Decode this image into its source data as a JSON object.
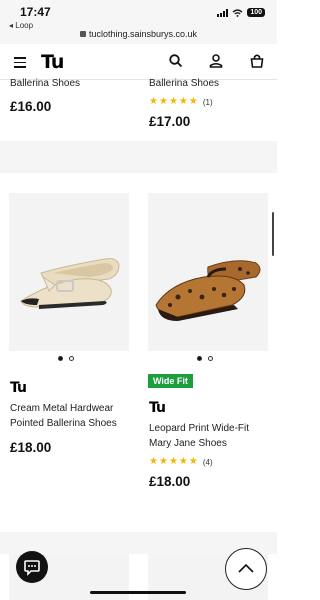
{
  "status_bar": {
    "time": "17:47",
    "back_label": "◂ Loop",
    "url": "tuclothing.sainsburys.co.uk",
    "battery": "100"
  },
  "header": {
    "logo": "Tu"
  },
  "top_row": {
    "left": {
      "title": "Ballerina Shoes",
      "price": "£16.00"
    },
    "right": {
      "title": "Ballerina Shoes",
      "rating_count": "(1)",
      "price": "£17.00"
    }
  },
  "products": [
    {
      "brand": "Tu",
      "title_line1": "Cream Metal Hardwear",
      "title_line2": "Pointed Ballerina Shoes",
      "price": "£18.00",
      "image_slide": 1,
      "image_slides": 2
    },
    {
      "badge": "Wide Fit",
      "brand": "Tu",
      "title_line1": "Leopard Print Wide-Fit",
      "title_line2": "Mary Jane Shoes",
      "rating_count": "(4)",
      "price": "£18.00",
      "image_slide": 1,
      "image_slides": 2
    }
  ],
  "colors": {
    "badge_green": "#1c9e3a",
    "star": "#f2b705"
  }
}
